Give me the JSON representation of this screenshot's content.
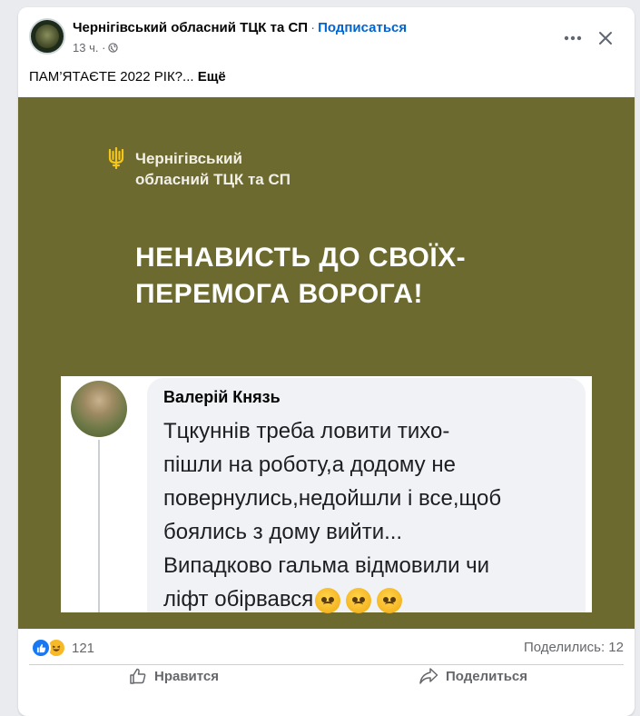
{
  "post": {
    "page_name": "Чернігівський обласний ТЦК та СП",
    "separator": "·",
    "subscribe_label": "Подписаться",
    "time": "13 ч. ·",
    "text": "ПАМ’ЯТАЄТЕ 2022 РІК?...",
    "see_more_label": "Ещё"
  },
  "image": {
    "background_color": "#6c6a2f",
    "org_line1": "Чернігівський",
    "org_line2": "обласний ТЦК та СП",
    "headline_line1": "НЕНАВИСТЬ ДО СВОЇХ-",
    "headline_line2": "ПЕРЕМОГА ВОРОГА!",
    "comment": {
      "author": "Валерій Князь",
      "lines": [
        "Тцкуннів треба ловити тихо-",
        "пішли на роботу,а додому не",
        "повернулись,недойшли і все,щоб",
        "боялись з дому вийти...",
        "Випадково гальма відмовили чи",
        "ліфт обірвався"
      ],
      "emoji": [
        "sad-face-emoji",
        "sad-face-emoji",
        "sad-face-emoji"
      ]
    }
  },
  "footer": {
    "reaction_count": "121",
    "shares": "Поделились: 12",
    "like_label": "Нравится",
    "share_label": "Поделиться"
  },
  "colors": {
    "link_blue": "#0064d1",
    "like_blue": "#1877f2",
    "muted_text": "#65676b",
    "image_olive": "#6c6a2f"
  }
}
